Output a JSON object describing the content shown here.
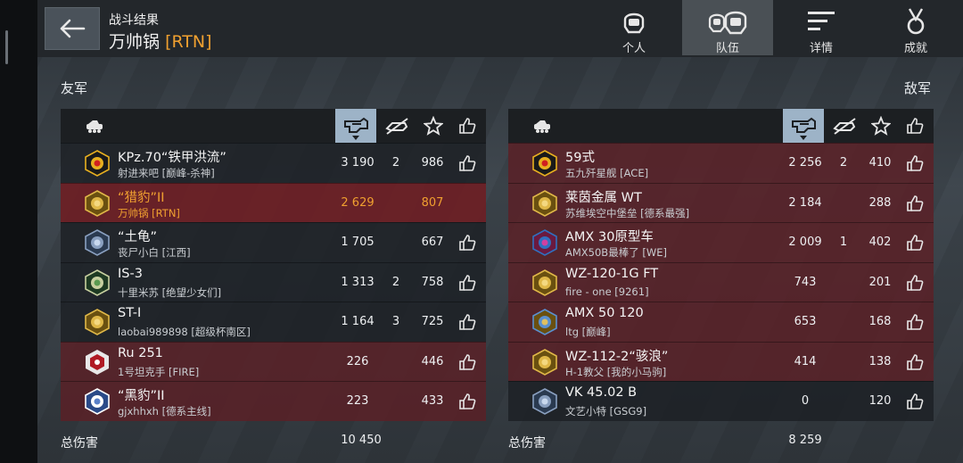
{
  "header": {
    "subtitle": "战斗结果",
    "player_name": "万帅锅",
    "player_tag": "[RTN]"
  },
  "tabs": [
    {
      "label": "个人",
      "icon": "person-helmet-icon",
      "active": false
    },
    {
      "label": "队伍",
      "icon": "team-helmets-icon",
      "active": true
    },
    {
      "label": "详情",
      "icon": "details-list-icon",
      "active": false
    },
    {
      "label": "成就",
      "icon": "medal-icon",
      "active": false
    }
  ],
  "allies": {
    "label": "友军",
    "total_label": "总伤害",
    "total_damage": "10 450",
    "rows": [
      {
        "tank": "KPz.70“铁甲洪流”",
        "player": "射进来吧 [巅峰-杀神]",
        "damage": "3 190",
        "kills": "2",
        "xp": "986",
        "like": true,
        "style": "dark",
        "badge": "lightning-badge"
      },
      {
        "tank": "“猎豹”II",
        "player": "万帅锅 [RTN]",
        "damage": "2 629",
        "kills": "",
        "xp": "807",
        "like": false,
        "style": "mine",
        "badge": "lion-badge"
      },
      {
        "tank": "“土龟”",
        "player": "丧尸小白 [江西]",
        "damage": "1 705",
        "kills": "",
        "xp": "667",
        "like": true,
        "style": "dark",
        "badge": "shield-badge"
      },
      {
        "tank": "IS-3",
        "player": "十里米苏 [绝望少女们]",
        "damage": "1 313",
        "kills": "2",
        "xp": "758",
        "like": true,
        "style": "dark",
        "badge": "tank-badge"
      },
      {
        "tank": "ST-I",
        "player": "laobai989898 [超级杯南区]",
        "damage": "1 164",
        "kills": "3",
        "xp": "725",
        "like": true,
        "style": "dark",
        "badge": "lion-badge"
      },
      {
        "tank": "Ru 251",
        "player": "1号坦克手 [FIRE]",
        "damage": "226",
        "kills": "",
        "xp": "446",
        "like": true,
        "style": "red",
        "badge": "hexagon-badge"
      },
      {
        "tank": "“黑豹”II",
        "player": "gjxhhxh [德系主线]",
        "damage": "223",
        "kills": "",
        "xp": "433",
        "like": true,
        "style": "red",
        "badge": "crossed-guns-badge"
      }
    ]
  },
  "enemies": {
    "label": "敌军",
    "total_label": "总伤害",
    "total_damage": "8 259",
    "rows": [
      {
        "tank": "59式",
        "player": "五九歼星舰 [ACE]",
        "damage": "2 256",
        "kills": "2",
        "xp": "410",
        "like": true,
        "style": "red",
        "badge": "lightning-badge"
      },
      {
        "tank": "莱茵金属 WT",
        "player": "苏维埃空中堡垒 [德系最强]",
        "damage": "2 184",
        "kills": "",
        "xp": "288",
        "like": true,
        "style": "red",
        "badge": "lion-badge"
      },
      {
        "tank": "AMX 30原型车",
        "player": "AMX50B最棒了 [WE]",
        "damage": "2 009",
        "kills": "1",
        "xp": "402",
        "like": true,
        "style": "red",
        "badge": "gear-badge"
      },
      {
        "tank": "WZ-120-1G FT",
        "player": "fire - one [9261]",
        "damage": "743",
        "kills": "",
        "xp": "201",
        "like": true,
        "style": "red",
        "badge": "lion-badge"
      },
      {
        "tank": "AMX 50 120",
        "player": "ltg [巅峰]",
        "damage": "653",
        "kills": "",
        "xp": "168",
        "like": true,
        "style": "red",
        "badge": "wings-badge"
      },
      {
        "tank": "WZ-112-2“骇浪”",
        "player": "H-1教父 [我的小马驹]",
        "damage": "414",
        "kills": "",
        "xp": "138",
        "like": true,
        "style": "red",
        "badge": "lion-badge"
      },
      {
        "tank": "VK 45.02 B",
        "player": "文艺小特 [GSG9]",
        "damage": "0",
        "kills": "",
        "xp": "120",
        "like": true,
        "style": "dark",
        "badge": "shield-badge"
      }
    ]
  },
  "colors": {
    "accent_orange": "#f0a030",
    "sorted_header": "#9db3c7",
    "enemy_row": "#5c2026",
    "ally_row": "#1c2024"
  }
}
